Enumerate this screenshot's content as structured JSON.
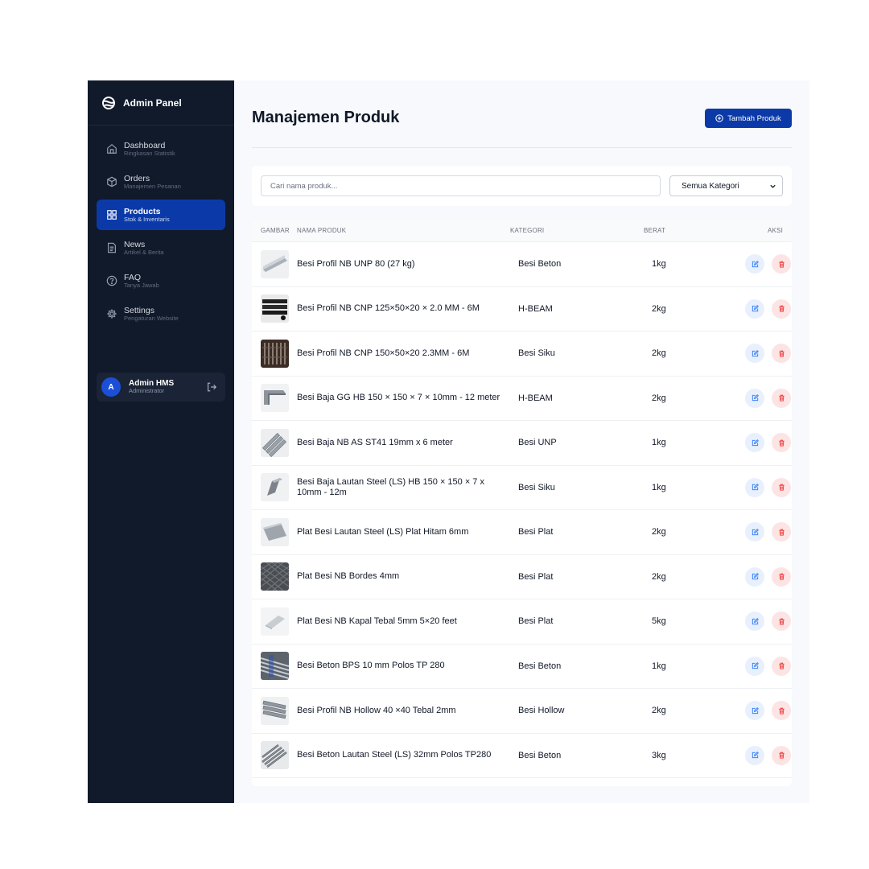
{
  "sidebar": {
    "brand": "Admin Panel",
    "items": [
      {
        "label": "Dashboard",
        "sub": "Ringkasan Statistik",
        "icon": "home-icon"
      },
      {
        "label": "Orders",
        "sub": "Manajemen Pesanan",
        "icon": "box-icon"
      },
      {
        "label": "Products",
        "sub": "Stok & Inventaris",
        "icon": "grid-icon",
        "active": true
      },
      {
        "label": "News",
        "sub": "Artikel & Berita",
        "icon": "document-icon"
      },
      {
        "label": "FAQ",
        "sub": "Tanya Jawab",
        "icon": "help-circle-icon"
      },
      {
        "label": "Settings",
        "sub": "Pengaturan Website",
        "icon": "gear-icon"
      }
    ],
    "user": {
      "initial": "A",
      "name": "Admin HMS",
      "role": "Administrator"
    }
  },
  "header": {
    "title": "Manajemen Produk",
    "add_label": "Tambah Produk"
  },
  "filters": {
    "search_placeholder": "Cari nama produk...",
    "category_selected": "Semua Kategori"
  },
  "table": {
    "headers": {
      "image": "GAMBAR",
      "name": "NAMA PRODUK",
      "category": "KATEGORI",
      "weight": "BERAT",
      "actions": "AKSI"
    },
    "rows": [
      {
        "name": "Besi Profil NB UNP 80 (27 kg)",
        "category": "Besi Beton",
        "weight": "1kg"
      },
      {
        "name": "Besi Profil NB CNP 125×50×20 × 2.0 MM - 6M",
        "category": "H-BEAM",
        "weight": "2kg"
      },
      {
        "name": "Besi Profil NB CNP 150×50×20 2.3MM - 6M",
        "category": "Besi Siku",
        "weight": "2kg"
      },
      {
        "name": "Besi Baja GG HB 150 × 150 × 7 × 10mm - 12 meter",
        "category": "H-BEAM",
        "weight": "2kg"
      },
      {
        "name": "Besi Baja NB AS ST41 19mm x 6 meter",
        "category": "Besi UNP",
        "weight": "1kg"
      },
      {
        "name": "Besi Baja Lautan Steel (LS) HB 150 × 150 × 7 x 10mm - 12m",
        "category": "Besi Siku",
        "weight": "1kg"
      },
      {
        "name": "Plat Besi Lautan Steel (LS) Plat Hitam 6mm",
        "category": "Besi Plat",
        "weight": "2kg"
      },
      {
        "name": "Plat Besi NB Bordes 4mm",
        "category": "Besi Plat",
        "weight": "2kg"
      },
      {
        "name": "Plat Besi NB Kapal Tebal 5mm 5×20 feet",
        "category": "Besi Plat",
        "weight": "5kg"
      },
      {
        "name": "Besi Beton BPS 10 mm Polos TP 280",
        "category": "Besi Beton",
        "weight": "1kg"
      },
      {
        "name": "Besi Profil NB Hollow 40 ×40 Tebal 2mm",
        "category": "Besi Hollow",
        "weight": "2kg"
      },
      {
        "name": "Besi Beton Lautan Steel (LS) 32mm Polos TP280",
        "category": "Besi Beton",
        "weight": "3kg"
      }
    ]
  },
  "colors": {
    "sidebar_bg": "#111a2b",
    "primary": "#0b3aa8",
    "edit": "#3b82f6",
    "delete": "#ef4444"
  }
}
